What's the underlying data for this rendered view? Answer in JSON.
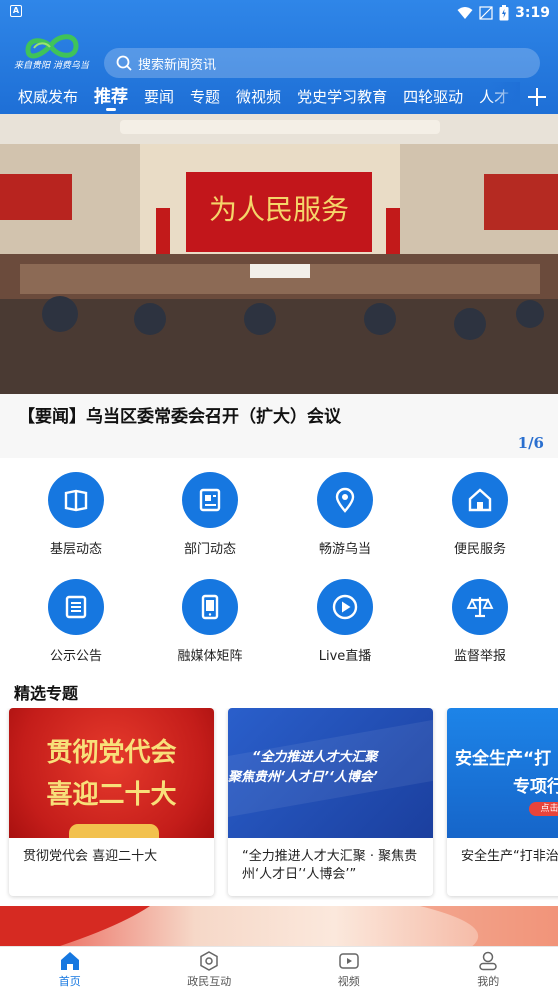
{
  "status_bar": {
    "time": "3:19",
    "left_icon_letter": "A"
  },
  "header": {
    "logo_caption": "来自贵阳 消费乌当",
    "search_placeholder": "搜索新闻资讯",
    "tabs": [
      {
        "label": "权威发布"
      },
      {
        "label": "推荐",
        "active": true
      },
      {
        "label": "要闻"
      },
      {
        "label": "专题"
      },
      {
        "label": "微视频"
      },
      {
        "label": "党史学习教育"
      },
      {
        "label": "四轮驱动"
      },
      {
        "label": "人才"
      }
    ],
    "accent_color": "#1e6fd6"
  },
  "banner": {
    "backdrop_text": "为人民服务",
    "caption": "【要闻】乌当区委常委会召开（扩大）会议",
    "page_indicator": "1/6"
  },
  "quick_links": [
    {
      "label": "基层动态",
      "icon": "book-icon"
    },
    {
      "label": "部门动态",
      "icon": "newspaper-icon"
    },
    {
      "label": "畅游乌当",
      "icon": "location-pin-icon"
    },
    {
      "label": "便民服务",
      "icon": "home-icon"
    },
    {
      "label": "公示公告",
      "icon": "list-icon"
    },
    {
      "label": "融媒体矩阵",
      "icon": "tablet-icon"
    },
    {
      "label": "Live直播",
      "icon": "play-icon"
    },
    {
      "label": "监督举报",
      "icon": "scales-icon"
    }
  ],
  "featured": {
    "title": "精选专题",
    "cards": [
      {
        "image_line1": "贯彻党代会",
        "image_line2": "喜迎二十大",
        "title": "贯彻党代会 喜迎二十大"
      },
      {
        "image_line1": "“全力推进人才大汇聚",
        "image_line2": "聚焦贵州‘人才日’‘人博会’",
        "title": "“全力推进人才大汇聚 · 聚焦贵州‘人才日’‘人博会’”"
      },
      {
        "image_line1": "安全生产“打",
        "image_line2": "专项行",
        "image_badge": "点击查",
        "title": "安全生产“打非治违"
      }
    ]
  },
  "bottom_nav": [
    {
      "label": "首页",
      "icon": "home-icon",
      "active": true
    },
    {
      "label": "政民互动",
      "icon": "interaction-icon"
    },
    {
      "label": "视频",
      "icon": "video-icon"
    },
    {
      "label": "我的",
      "icon": "user-icon"
    }
  ]
}
